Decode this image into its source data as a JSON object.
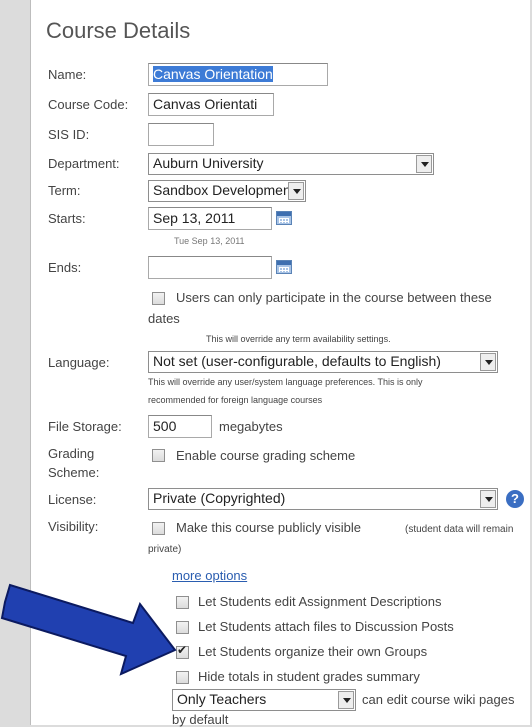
{
  "page": {
    "title": "Course Details"
  },
  "fields": {
    "name": {
      "label": "Name:",
      "value": "Canvas Orientation"
    },
    "course_code": {
      "label": "Course Code:",
      "value": "Canvas Orientati"
    },
    "sis_id": {
      "label": "SIS ID:",
      "value": ""
    },
    "department": {
      "label": "Department:",
      "value": "Auburn University"
    },
    "term": {
      "label": "Term:",
      "value": "Sandbox Development"
    },
    "starts": {
      "label": "Starts:",
      "value": "Sep 13, 2011",
      "hint": "Tue Sep 13, 2011"
    },
    "ends": {
      "label": "Ends:",
      "value": ""
    },
    "dates_restrict": {
      "line1": "Users can only participate in the course between these",
      "line2": "dates",
      "note": "This will override any term availability settings."
    },
    "language": {
      "label": "Language:",
      "value": "Not set (user-configurable, defaults to English)",
      "note1": "This will override any user/system language preferences. This is only",
      "note2": "recommended for foreign language courses"
    },
    "file_storage": {
      "label": "File Storage:",
      "value": "500",
      "unit": "megabytes"
    },
    "grading": {
      "label1": "Grading",
      "label2": "Scheme:",
      "checkbox_label": "Enable course grading scheme"
    },
    "license": {
      "label": "License:",
      "value": "Private (Copyrighted)",
      "help_icon": "?"
    },
    "visibility": {
      "label": "Visibility:",
      "checkbox_label": "Make this course publicly visible",
      "note": "(student data will remain",
      "note2": "private)"
    }
  },
  "more_options": {
    "link": "more options",
    "options": [
      {
        "label": "Let Students edit Assignment Descriptions",
        "checked": false
      },
      {
        "label": "Let Students attach files to Discussion Posts",
        "checked": false
      },
      {
        "label": "Let Students organize their own Groups",
        "checked": true
      },
      {
        "label": "Hide totals in student grades summary",
        "checked": false
      }
    ],
    "wiki_editor": {
      "value": "Only Teachers",
      "suffix": "can edit course wiki pages",
      "suffix2": "by default"
    }
  },
  "annotation": {
    "arrow_color": "#2040b0",
    "arrow_outline": "#0b1a60"
  }
}
